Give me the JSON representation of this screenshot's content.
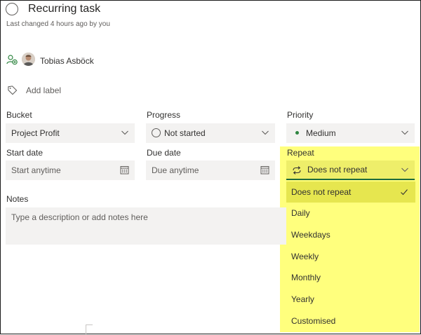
{
  "task": {
    "title": "Recurring task",
    "last_changed": "Last changed 4 hours ago by you"
  },
  "assignee": {
    "name": "Tobias Asböck"
  },
  "label": {
    "add_label": "Add label"
  },
  "fields": {
    "bucket": {
      "label": "Bucket",
      "value": "Project Profit"
    },
    "progress": {
      "label": "Progress",
      "value": "Not started"
    },
    "priority": {
      "label": "Priority",
      "value": "Medium",
      "color": "#2e8540"
    },
    "start_date": {
      "label": "Start date",
      "placeholder": "Start anytime"
    },
    "due_date": {
      "label": "Due date",
      "placeholder": "Due anytime"
    },
    "repeat": {
      "label": "Repeat",
      "value": "Does not repeat"
    },
    "notes": {
      "label": "Notes",
      "placeholder": "Type a description or add notes here"
    }
  },
  "repeat_menu": {
    "items": [
      "Does not repeat",
      "Daily",
      "Weekdays",
      "Weekly",
      "Monthly",
      "Yearly",
      "Customised"
    ],
    "selected_index": 0
  },
  "colors": {
    "highlight": "#ffff66",
    "accent_green": "#1e6b3c",
    "field_bg": "#f3f2f1"
  }
}
